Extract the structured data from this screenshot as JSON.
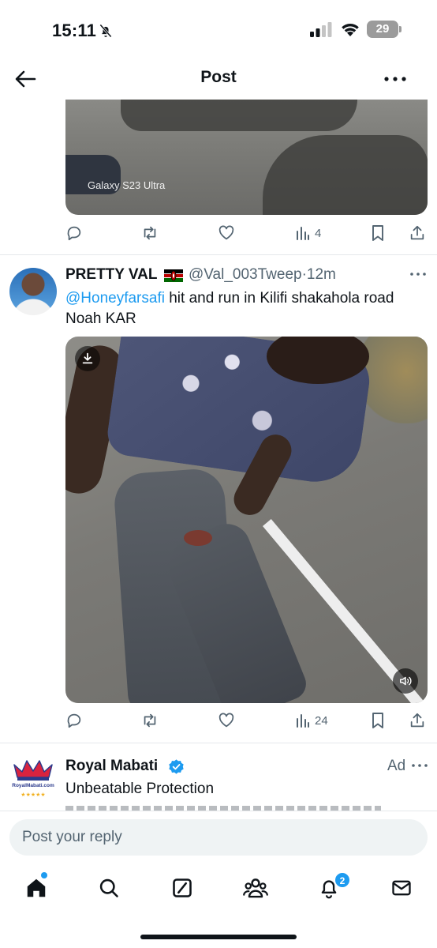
{
  "status_bar": {
    "time": "15:11",
    "battery": "29",
    "icons": [
      "bell-slash-icon",
      "signal-icon",
      "wifi-icon",
      "battery-icon"
    ]
  },
  "header": {
    "title": "Post",
    "back_icon": "arrow-left-icon",
    "more_icon": "more-horizontal-icon"
  },
  "previous_post": {
    "media_watermark": "Galaxy S23 Ultra",
    "actions": {
      "views": "4"
    }
  },
  "post": {
    "author_name": "PRETTY VAL",
    "flag": "kenya-flag",
    "handle": "@Val_003Tweep",
    "separator": "·",
    "time_ago": "12m",
    "mention": "@Honeyfarsafi",
    "text": " hit and run in Kilifi shakahola road Noah KAR",
    "actions": {
      "views": "24"
    }
  },
  "ad": {
    "name": "Royal Mabati",
    "label": "Ad",
    "text": "Unbeatable Protection",
    "logo_text": "RoyalMabati.com"
  },
  "reply": {
    "placeholder": "Post your reply"
  },
  "tab_bar": {
    "items": [
      "home-icon",
      "search-icon",
      "grok-icon",
      "communities-icon",
      "notifications-icon",
      "messages-icon"
    ],
    "notifications_badge": "2"
  },
  "colors": {
    "accent": "#1d9bf0",
    "muted": "#536471",
    "text": "#0f1419"
  }
}
